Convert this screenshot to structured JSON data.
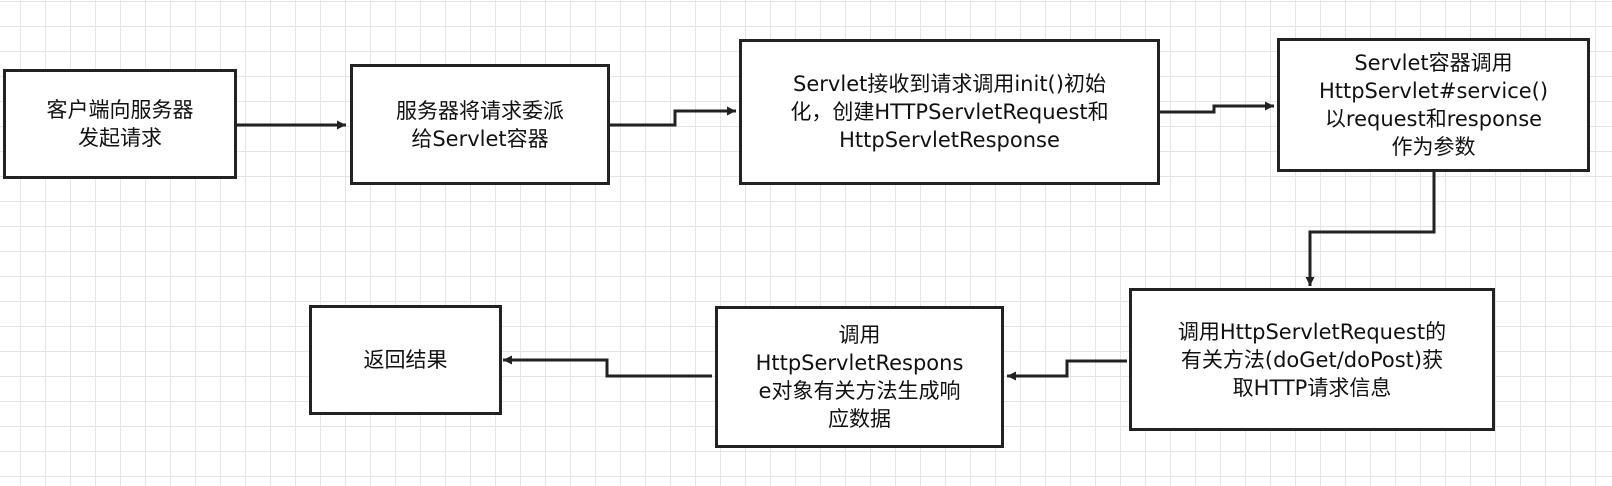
{
  "diagram": {
    "type": "flowchart",
    "nodes": [
      {
        "id": "client-request",
        "text": "客户端向服务器\n发起请求"
      },
      {
        "id": "server-dispatch",
        "text": "服务器将请求委派\n给Servlet容器"
      },
      {
        "id": "servlet-init",
        "text": "Servlet接收到请求调用init()初始\n化，创建HTTPServletRequest和\nHttpServletResponse"
      },
      {
        "id": "container-service",
        "text": "Servlet容器调用\nHttpServlet#service()\n以request和response\n作为参数"
      },
      {
        "id": "request-method",
        "text": "调用HttpServletRequest的\n有关方法(doGet/doPost)获\n取HTTP请求信息"
      },
      {
        "id": "response-generate",
        "text": "调用\nHttpServletRespons\ne对象有关方法生成响\n应数据"
      },
      {
        "id": "return-result",
        "text": "返回结果"
      }
    ],
    "edges": [
      {
        "from": "client-request",
        "to": "server-dispatch"
      },
      {
        "from": "server-dispatch",
        "to": "servlet-init"
      },
      {
        "from": "servlet-init",
        "to": "container-service"
      },
      {
        "from": "container-service",
        "to": "request-method"
      },
      {
        "from": "request-method",
        "to": "response-generate"
      },
      {
        "from": "response-generate",
        "to": "return-result"
      }
    ]
  },
  "colors": {
    "stroke": "#222222",
    "text": "#111111",
    "node_fill": "#ffffff",
    "grid": "#e4e4e4",
    "background": "#ffffff"
  }
}
